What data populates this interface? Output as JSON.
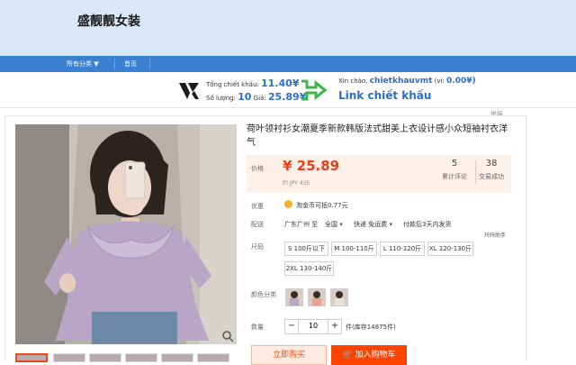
{
  "store": {
    "name": "盛靓靓女装"
  },
  "nav": {
    "all_categories": "所有分类",
    "home": "首页"
  },
  "extension": {
    "total_label": "Tổng chiết khấu:",
    "total_value": "11.40¥",
    "qty_label": "Số lượng:",
    "qty_value": "10",
    "price_label": "Giá:",
    "price_value": "25.89¥",
    "greeting": "Xin chào,",
    "username": "chietkhauvmt",
    "wallet_label": "(ví:",
    "wallet_value": "0.00¥)",
    "link_text": "Link chiết khấu"
  },
  "report": "举报",
  "product": {
    "title": "荷叶领衬衫女潮夏季新款韩版法式甜美上衣设计感小众短袖衬衣洋气",
    "price_label": "价格",
    "price": "¥ 25.89",
    "jpy": "约 JPY 435",
    "reviews_count": "5",
    "reviews_label": "累计评论",
    "sales_count": "38",
    "sales_label": "交易成功",
    "promo_label": "优惠",
    "promo_text": "淘金币可抵0.77元",
    "ship_label": "配送",
    "ship_from": "广东广州 至",
    "ship_to": "全国",
    "ship_express": "快递 免运费",
    "ship_time": "付款后3天内发货",
    "size_help": "尺码助手",
    "size_label": "尺码",
    "sizes": [
      "S 100斤以下",
      "M 100-110斤",
      "L 110-120斤",
      "XL 120-130斤",
      "2XL 130-140斤"
    ],
    "color_label": "颜色分类",
    "qty_label": "数量",
    "qty_value": "10",
    "stock": "件(库存14875件)",
    "buy_now": "立即购买",
    "add_cart": "加入购物车"
  }
}
